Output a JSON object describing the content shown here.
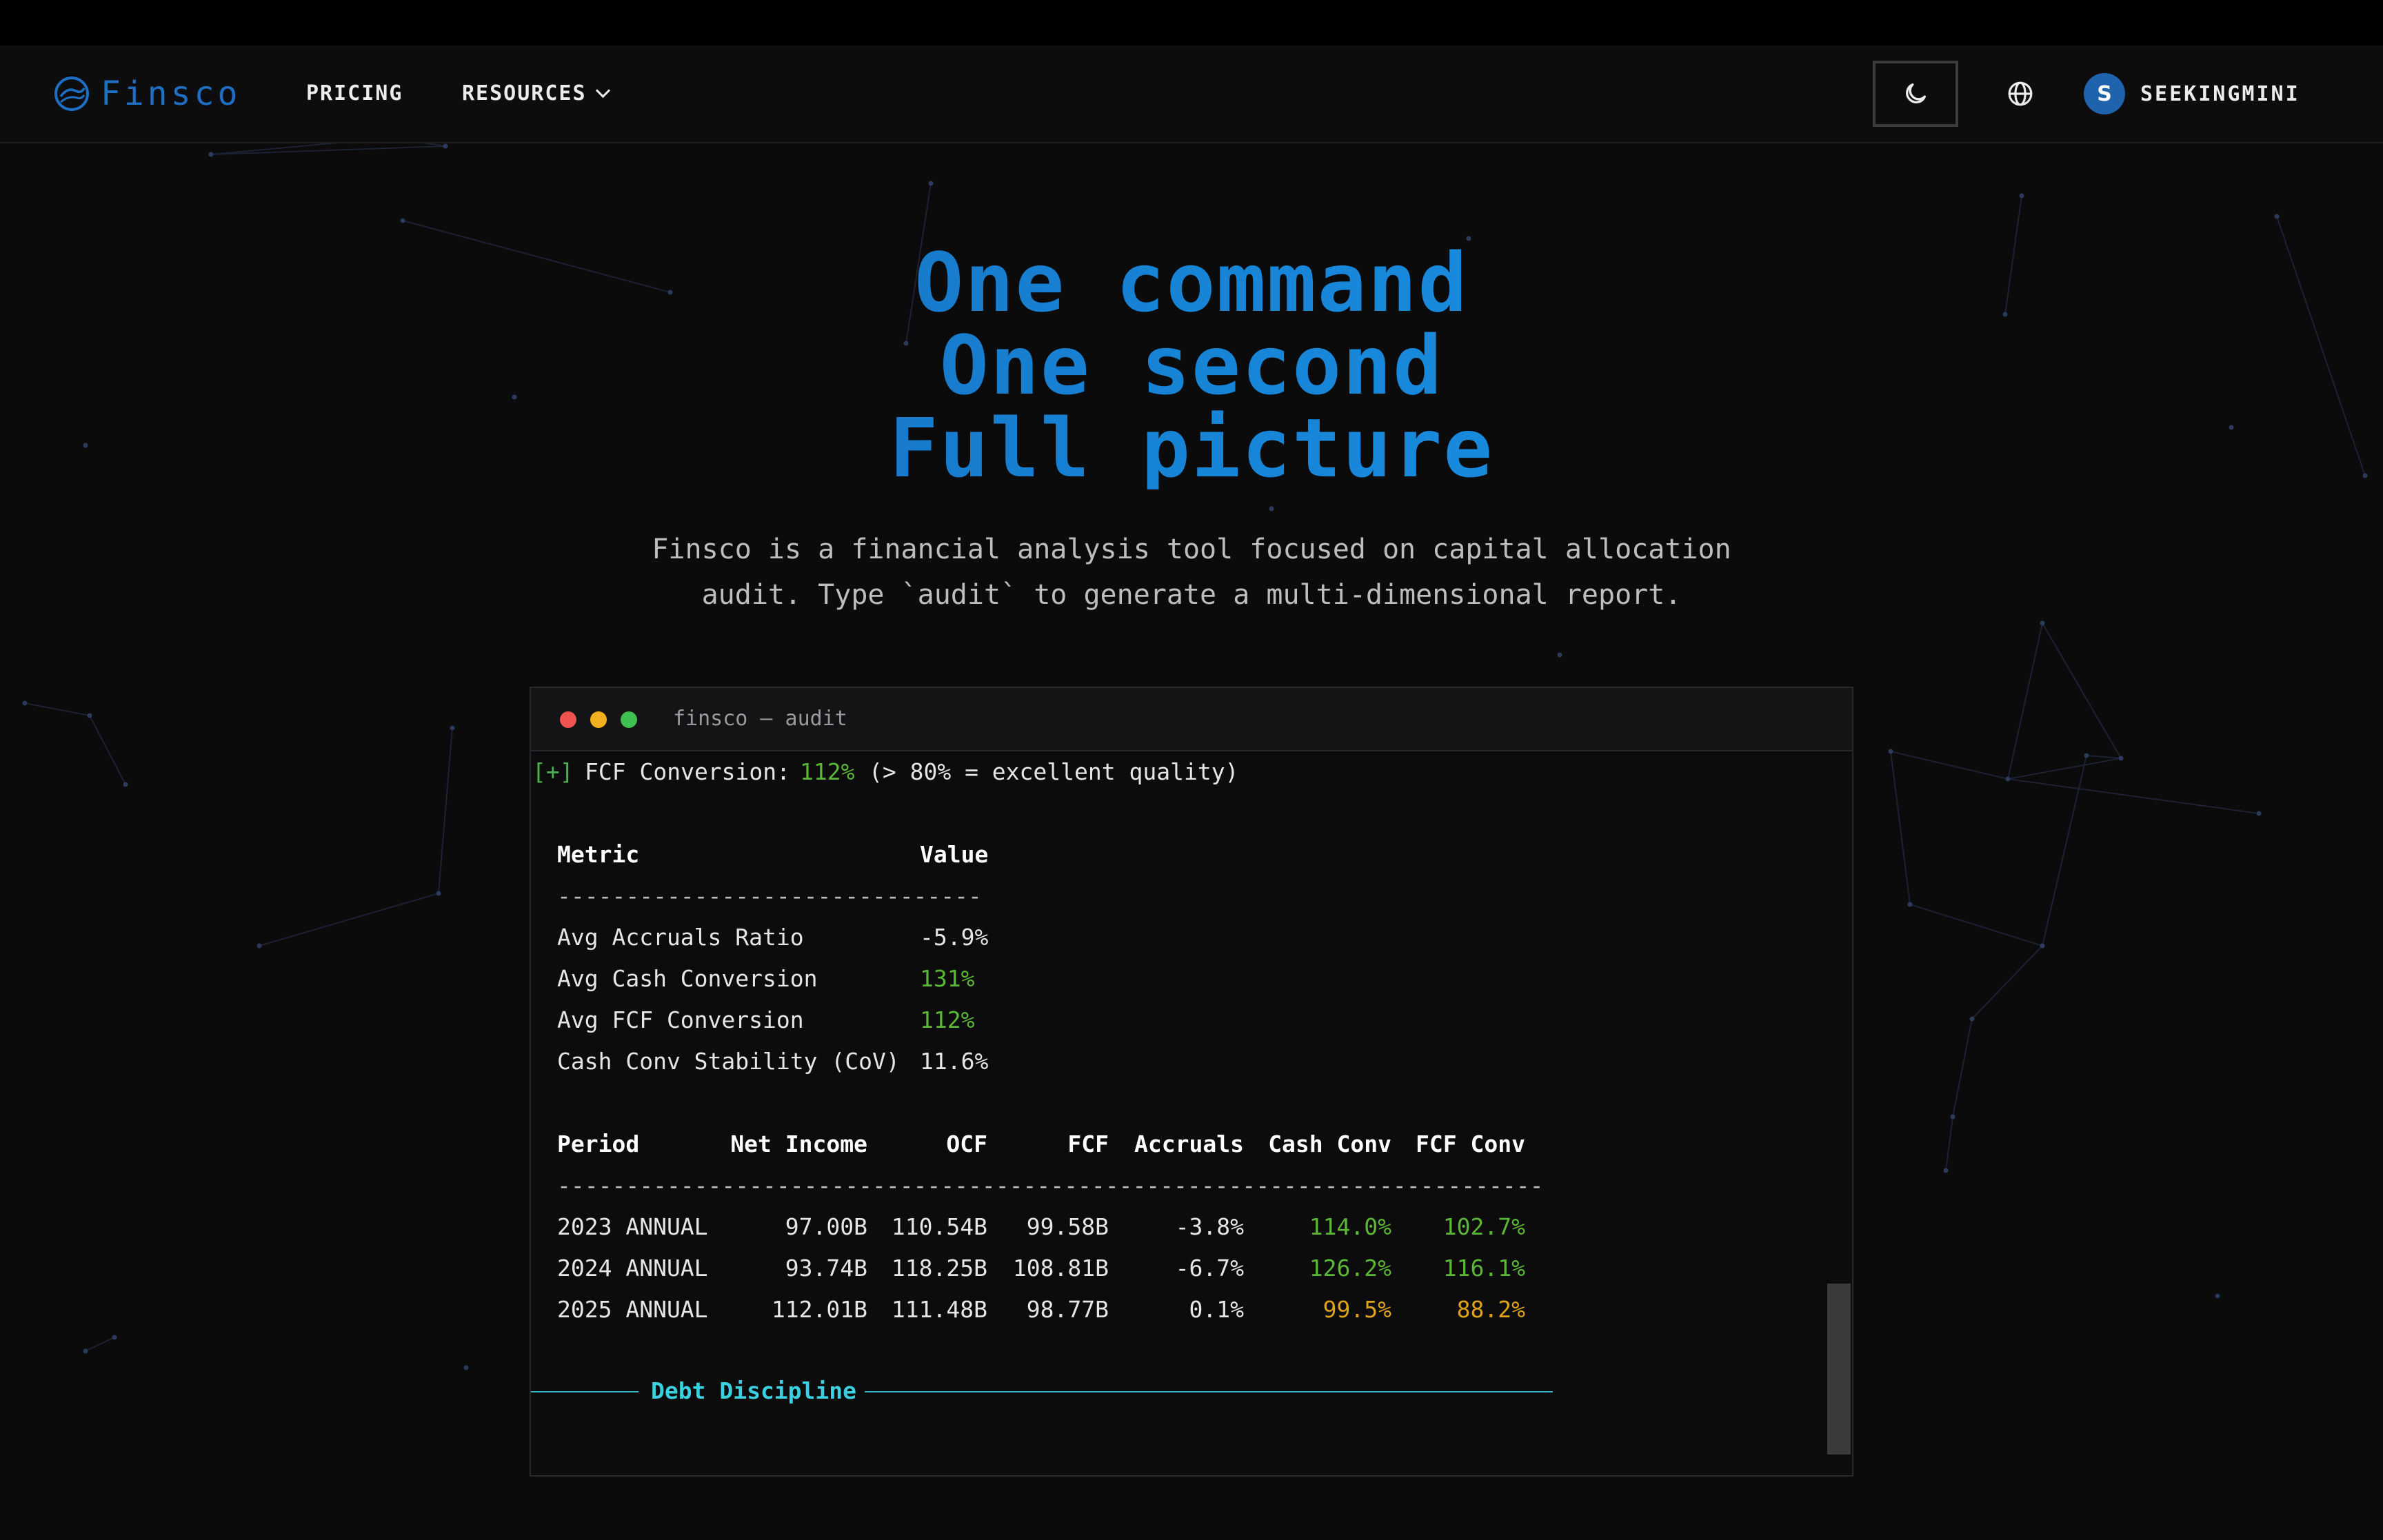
{
  "brand": {
    "name": "Finsco"
  },
  "nav": {
    "pricing": "PRICING",
    "resources": "RESOURCES",
    "user_initial": "S",
    "username": "SEEKINGMINI"
  },
  "hero": {
    "line1": "One command",
    "line2": "One second",
    "line3": "Full picture",
    "subtitle_line1": "Finsco is a financial analysis tool focused on capital allocation",
    "subtitle_line2": "audit. Type `audit` to generate a multi-dimensional report."
  },
  "terminal": {
    "title": "finsco — audit",
    "fcf_line": {
      "marker": "[+]",
      "label": "FCF Conversion:",
      "value": "112%",
      "note": "(> 80% = excellent quality)"
    },
    "metrics": {
      "headers": [
        "Metric",
        "Value"
      ],
      "separator": "-------------------------------",
      "rows": [
        {
          "metric": "Avg Accruals Ratio",
          "value": "-5.9%",
          "tone": "plain"
        },
        {
          "metric": "Avg Cash Conversion",
          "value": "131%",
          "tone": "green"
        },
        {
          "metric": "Avg FCF Conversion",
          "value": "112%",
          "tone": "green"
        },
        {
          "metric": "Cash Conv Stability (CoV)",
          "value": "11.6%",
          "tone": "plain"
        }
      ]
    },
    "periods": {
      "headers": [
        "Period",
        "Net Income",
        "OCF",
        "FCF",
        "Accruals",
        "Cash Conv",
        "FCF Conv"
      ],
      "separator": "------------------------------------------------------------------------",
      "rows": [
        {
          "period": "2023 ANNUAL",
          "net_income": "97.00B",
          "ocf": "110.54B",
          "fcf": "99.58B",
          "accruals": "-3.8%",
          "cash_conv": "114.0%",
          "fcf_conv": "102.7%",
          "cash_tone": "green",
          "fcf_tone": "green"
        },
        {
          "period": "2024 ANNUAL",
          "net_income": "93.74B",
          "ocf": "118.25B",
          "fcf": "108.81B",
          "accruals": "-6.7%",
          "cash_conv": "126.2%",
          "fcf_conv": "116.1%",
          "cash_tone": "green",
          "fcf_tone": "green"
        },
        {
          "period": "2025 ANNUAL",
          "net_income": "112.01B",
          "ocf": "111.48B",
          "fcf": "98.77B",
          "accruals": "0.1%",
          "cash_conv": "99.5%",
          "fcf_conv": "88.2%",
          "cash_tone": "amber",
          "fcf_tone": "amber"
        }
      ]
    },
    "section": "Debt Discipline"
  },
  "colors": {
    "accent": "#1784d6",
    "good": "#5ab834",
    "warn": "#e0a21a",
    "section": "#3ad0e0"
  }
}
